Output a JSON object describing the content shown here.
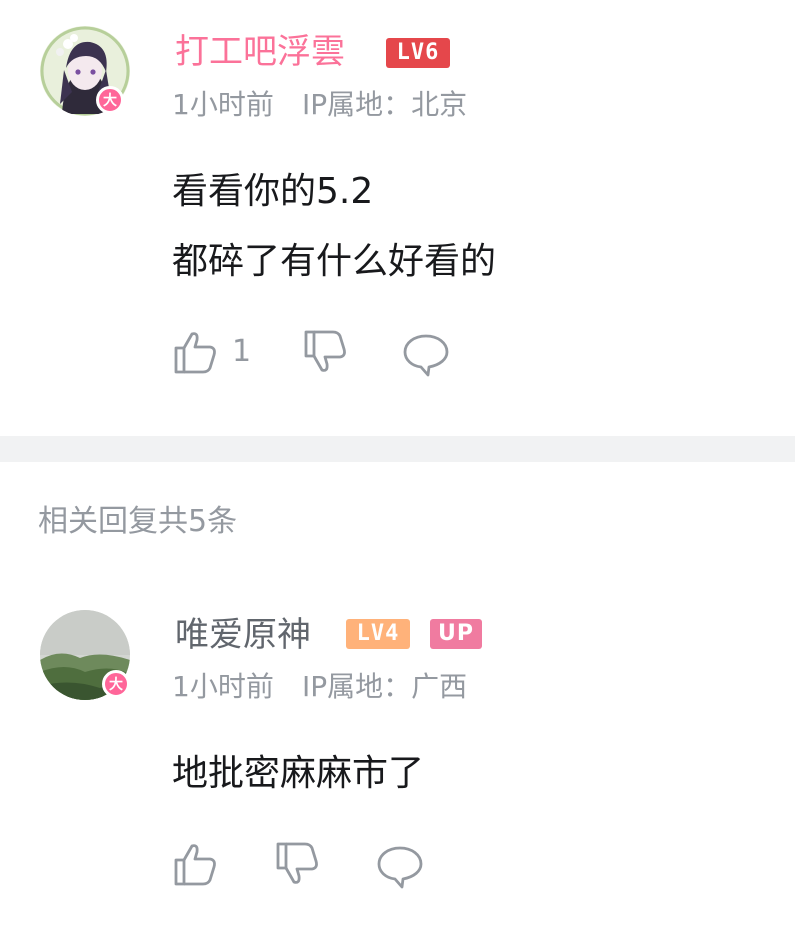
{
  "comment": {
    "username": "打工吧浮雲",
    "level": "LV6",
    "time": "1小时前",
    "ip_location": "IP属地：北京",
    "content_line1": "看看你的5.2",
    "content_line2": "都碎了有什么好看的",
    "like_count": "1",
    "vip_badge": "大",
    "username_color": "#fb7299",
    "level_color": "#e5474b"
  },
  "replies_header": "相关回复共5条",
  "reply": {
    "username": "唯爱原神",
    "level": "LV4",
    "up_badge": "UP",
    "time": "1小时前",
    "ip_location": "IP属地：广西",
    "content": "地批密麻麻市了",
    "vip_badge": "大",
    "username_color": "#61666d",
    "level_color": "#ffb27a",
    "up_badge_color": "#f07ba0"
  },
  "icons": {
    "like": "thumbs-up-icon",
    "dislike": "thumbs-down-icon",
    "reply": "speech-bubble-icon"
  }
}
